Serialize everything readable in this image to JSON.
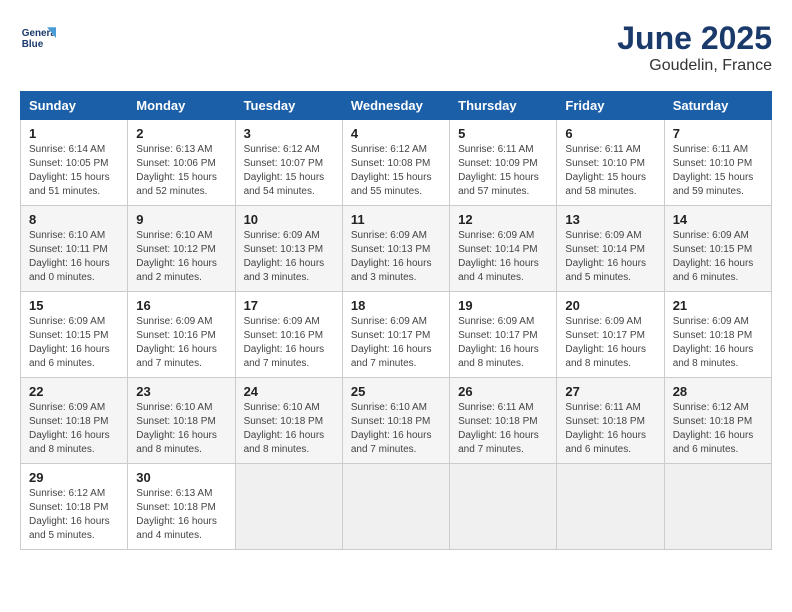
{
  "header": {
    "logo_line1": "General",
    "logo_line2": "Blue",
    "month": "June 2025",
    "location": "Goudelin, France"
  },
  "weekdays": [
    "Sunday",
    "Monday",
    "Tuesday",
    "Wednesday",
    "Thursday",
    "Friday",
    "Saturday"
  ],
  "weeks": [
    [
      {
        "day": "1",
        "info": "Sunrise: 6:14 AM\nSunset: 10:05 PM\nDaylight: 15 hours\nand 51 minutes."
      },
      {
        "day": "2",
        "info": "Sunrise: 6:13 AM\nSunset: 10:06 PM\nDaylight: 15 hours\nand 52 minutes."
      },
      {
        "day": "3",
        "info": "Sunrise: 6:12 AM\nSunset: 10:07 PM\nDaylight: 15 hours\nand 54 minutes."
      },
      {
        "day": "4",
        "info": "Sunrise: 6:12 AM\nSunset: 10:08 PM\nDaylight: 15 hours\nand 55 minutes."
      },
      {
        "day": "5",
        "info": "Sunrise: 6:11 AM\nSunset: 10:09 PM\nDaylight: 15 hours\nand 57 minutes."
      },
      {
        "day": "6",
        "info": "Sunrise: 6:11 AM\nSunset: 10:10 PM\nDaylight: 15 hours\nand 58 minutes."
      },
      {
        "day": "7",
        "info": "Sunrise: 6:11 AM\nSunset: 10:10 PM\nDaylight: 15 hours\nand 59 minutes."
      }
    ],
    [
      {
        "day": "8",
        "info": "Sunrise: 6:10 AM\nSunset: 10:11 PM\nDaylight: 16 hours\nand 0 minutes."
      },
      {
        "day": "9",
        "info": "Sunrise: 6:10 AM\nSunset: 10:12 PM\nDaylight: 16 hours\nand 2 minutes."
      },
      {
        "day": "10",
        "info": "Sunrise: 6:09 AM\nSunset: 10:13 PM\nDaylight: 16 hours\nand 3 minutes."
      },
      {
        "day": "11",
        "info": "Sunrise: 6:09 AM\nSunset: 10:13 PM\nDaylight: 16 hours\nand 3 minutes."
      },
      {
        "day": "12",
        "info": "Sunrise: 6:09 AM\nSunset: 10:14 PM\nDaylight: 16 hours\nand 4 minutes."
      },
      {
        "day": "13",
        "info": "Sunrise: 6:09 AM\nSunset: 10:14 PM\nDaylight: 16 hours\nand 5 minutes."
      },
      {
        "day": "14",
        "info": "Sunrise: 6:09 AM\nSunset: 10:15 PM\nDaylight: 16 hours\nand 6 minutes."
      }
    ],
    [
      {
        "day": "15",
        "info": "Sunrise: 6:09 AM\nSunset: 10:15 PM\nDaylight: 16 hours\nand 6 minutes."
      },
      {
        "day": "16",
        "info": "Sunrise: 6:09 AM\nSunset: 10:16 PM\nDaylight: 16 hours\nand 7 minutes."
      },
      {
        "day": "17",
        "info": "Sunrise: 6:09 AM\nSunset: 10:16 PM\nDaylight: 16 hours\nand 7 minutes."
      },
      {
        "day": "18",
        "info": "Sunrise: 6:09 AM\nSunset: 10:17 PM\nDaylight: 16 hours\nand 7 minutes."
      },
      {
        "day": "19",
        "info": "Sunrise: 6:09 AM\nSunset: 10:17 PM\nDaylight: 16 hours\nand 8 minutes."
      },
      {
        "day": "20",
        "info": "Sunrise: 6:09 AM\nSunset: 10:17 PM\nDaylight: 16 hours\nand 8 minutes."
      },
      {
        "day": "21",
        "info": "Sunrise: 6:09 AM\nSunset: 10:18 PM\nDaylight: 16 hours\nand 8 minutes."
      }
    ],
    [
      {
        "day": "22",
        "info": "Sunrise: 6:09 AM\nSunset: 10:18 PM\nDaylight: 16 hours\nand 8 minutes."
      },
      {
        "day": "23",
        "info": "Sunrise: 6:10 AM\nSunset: 10:18 PM\nDaylight: 16 hours\nand 8 minutes."
      },
      {
        "day": "24",
        "info": "Sunrise: 6:10 AM\nSunset: 10:18 PM\nDaylight: 16 hours\nand 8 minutes."
      },
      {
        "day": "25",
        "info": "Sunrise: 6:10 AM\nSunset: 10:18 PM\nDaylight: 16 hours\nand 7 minutes."
      },
      {
        "day": "26",
        "info": "Sunrise: 6:11 AM\nSunset: 10:18 PM\nDaylight: 16 hours\nand 7 minutes."
      },
      {
        "day": "27",
        "info": "Sunrise: 6:11 AM\nSunset: 10:18 PM\nDaylight: 16 hours\nand 6 minutes."
      },
      {
        "day": "28",
        "info": "Sunrise: 6:12 AM\nSunset: 10:18 PM\nDaylight: 16 hours\nand 6 minutes."
      }
    ],
    [
      {
        "day": "29",
        "info": "Sunrise: 6:12 AM\nSunset: 10:18 PM\nDaylight: 16 hours\nand 5 minutes."
      },
      {
        "day": "30",
        "info": "Sunrise: 6:13 AM\nSunset: 10:18 PM\nDaylight: 16 hours\nand 4 minutes."
      },
      {
        "day": "",
        "info": ""
      },
      {
        "day": "",
        "info": ""
      },
      {
        "day": "",
        "info": ""
      },
      {
        "day": "",
        "info": ""
      },
      {
        "day": "",
        "info": ""
      }
    ]
  ]
}
